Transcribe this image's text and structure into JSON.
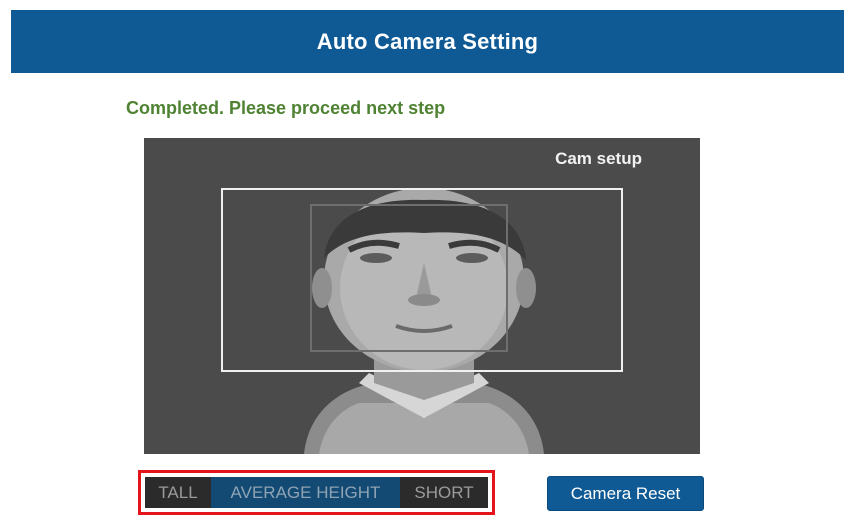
{
  "header": {
    "title": "Auto Camera Setting"
  },
  "status": {
    "message": "Completed. Please proceed next step"
  },
  "camera_view": {
    "label": "Cam setup"
  },
  "height_selector": {
    "options": [
      "TALL",
      "AVERAGE HEIGHT",
      "SHORT"
    ],
    "selected": "AVERAGE HEIGHT"
  },
  "actions": {
    "reset_label": "Camera Reset"
  },
  "colors": {
    "brand_blue": "#0f5a94",
    "status_green": "#4f8233",
    "highlight_red": "#e3151b"
  }
}
